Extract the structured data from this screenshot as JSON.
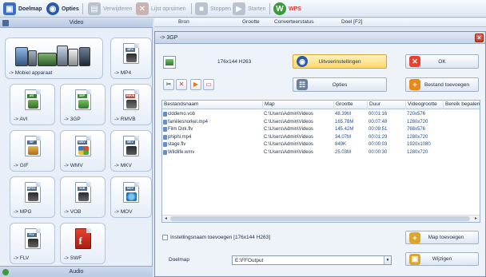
{
  "toolbar": {
    "doelmap": "Doelmap",
    "opties": "Opties",
    "verwijderen": "Verwijderen",
    "lijst_opruimen": "Lijst opruimen",
    "stoppen": "Stoppen",
    "starten": "Starten",
    "wps": "WPS"
  },
  "left_panel": {
    "video_header": "Video",
    "audio_header": "Audio",
    "tiles": [
      {
        "label": "-> Mobiel apparaat",
        "icon": "mobile-devices-icon"
      },
      {
        "label": "-> MP4",
        "band": "MP4",
        "icon": "mp4-file-icon"
      },
      {
        "label": "-> AVI",
        "band": "AVI",
        "icon": "avi-file-icon"
      },
      {
        "label": "-> 3GP",
        "band": "3GP",
        "icon": "3gp-file-icon"
      },
      {
        "label": "-> RMVB",
        "band": "RMVB",
        "icon": "rmvb-file-icon"
      },
      {
        "label": "-> GIF",
        "band": "GIF",
        "icon": "gif-file-icon"
      },
      {
        "label": "-> WMV",
        "band": "WMV",
        "icon": "wmv-file-icon"
      },
      {
        "label": "-> MKV",
        "band": "MKV",
        "icon": "mkv-file-icon"
      },
      {
        "label": "-> MPG",
        "band": "MPEG",
        "icon": "mpg-file-icon"
      },
      {
        "label": "-> VOB",
        "band": "VOB",
        "icon": "vob-file-icon"
      },
      {
        "label": "-> MOV",
        "band": "MOV",
        "icon": "mov-file-icon"
      },
      {
        "label": "-> FLV",
        "band": "FLV",
        "icon": "flv-file-icon"
      },
      {
        "label": "-> SWF",
        "band": "",
        "icon": "swf-file-icon"
      }
    ]
  },
  "header_bar": {
    "bron": "Bron",
    "grootte": "Grootte",
    "converteerstatus": "Converteerstatus",
    "doel": "Doel [F2]"
  },
  "dialog": {
    "title": "-> 3GP",
    "format_info": "176x144 H263",
    "uitvoerinstellingen": "Uitvoerinstellingen",
    "ok": "OK",
    "opties": "Opties",
    "bestand_toevoegen": "Bestand toevoegen",
    "columns": [
      "Bestandsnaam",
      "Map",
      "Grootte",
      "Duur",
      "Videogrootte",
      "Bereik bepalen"
    ],
    "rows": [
      {
        "name": "clddemo.vob",
        "map": "C:\\Users\\Admin\\Videos",
        "size": "48.39M",
        "duration": "00:01:16",
        "video": "720x576"
      },
      {
        "name": "familiesnorkel.mp4",
        "map": "C:\\Users\\Admin\\Videos",
        "size": "165.78M",
        "duration": "00:07:48",
        "video": "1280x720"
      },
      {
        "name": "Film Dirk.flv",
        "map": "C:\\Users\\Admin\\Videos",
        "size": "145.42M",
        "duration": "00:09:51",
        "video": "768x576"
      },
      {
        "name": "phiphi.mp4",
        "map": "C:\\Users\\Admin\\Videos",
        "size": "34.07M",
        "duration": "00:01:29",
        "video": "1280x720"
      },
      {
        "name": "stage.flv",
        "map": "C:\\Users\\Admin\\Videos",
        "size": "849K",
        "duration": "00:00:03",
        "video": "1920x1080"
      },
      {
        "name": "Wildlife.wmv",
        "map": "C:\\Users\\Admin\\Videos",
        "size": "25.03M",
        "duration": "00:00:30",
        "video": "1280x720"
      }
    ],
    "instelling_label": "Instellingsnaam toevoegen [176x144 H263]",
    "map_toevoegen": "Map toevoegen",
    "doelmap_label": "Doelmap",
    "doelmap_value": "E:\\FFOutput",
    "wijzigen": "Wijzigen"
  }
}
